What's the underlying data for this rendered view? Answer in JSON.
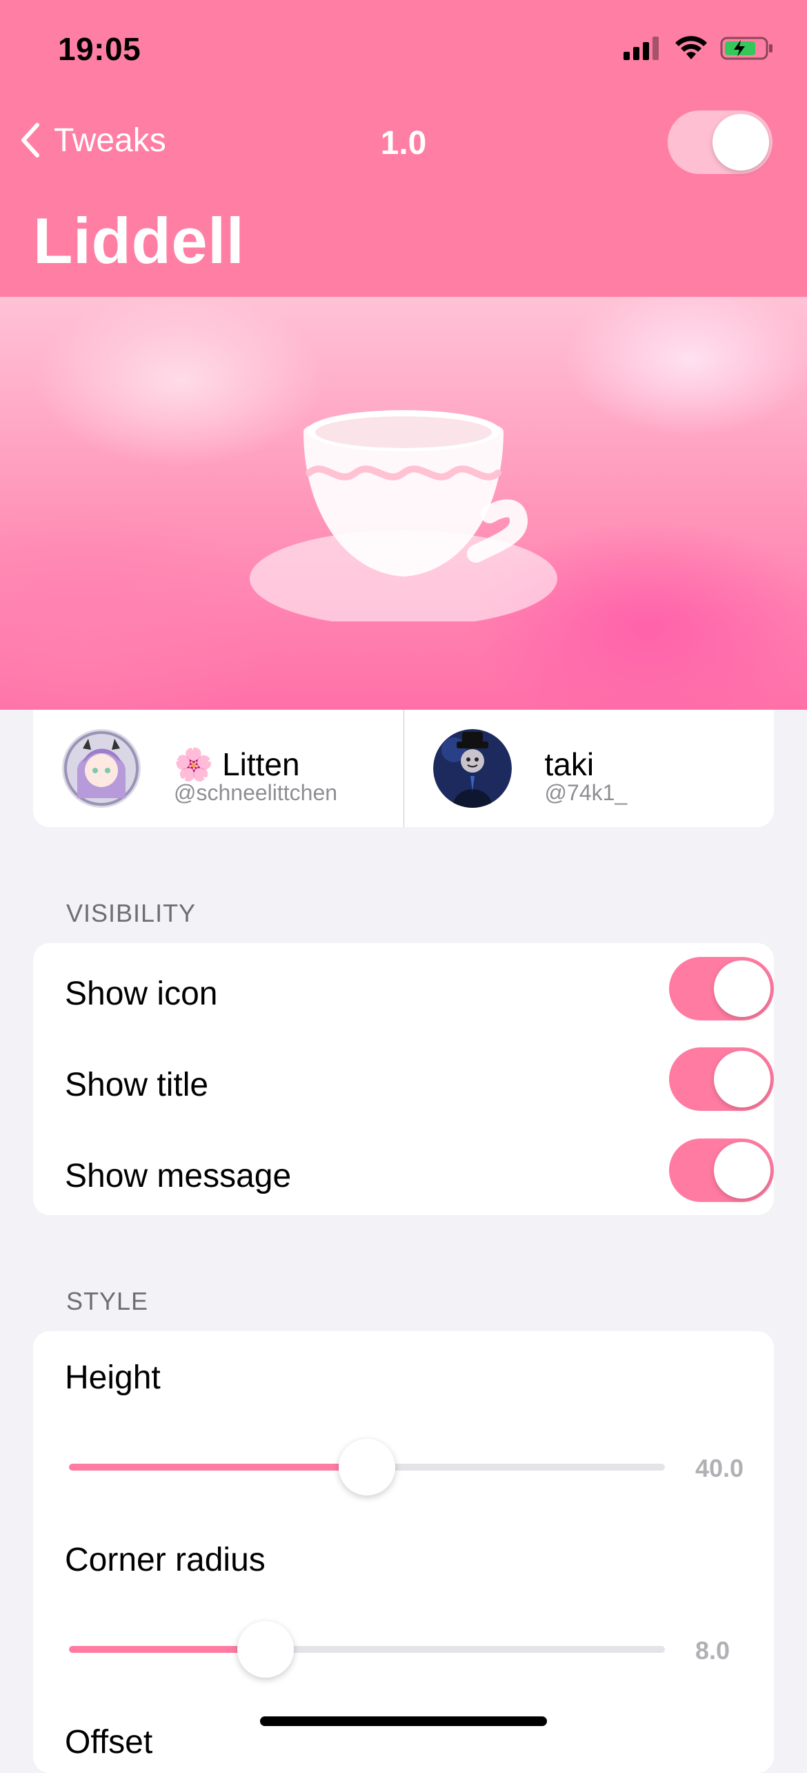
{
  "status_bar": {
    "time": "19:05"
  },
  "nav": {
    "back_label": "Tweaks",
    "title": "1.0",
    "enabled": true
  },
  "header": {
    "title": "Liddell"
  },
  "credits": [
    {
      "emoji": "🌸",
      "name": "Litten",
      "handle": "@schneelittchen"
    },
    {
      "name": "taki",
      "handle": "@74k1_"
    }
  ],
  "visibility": {
    "header": "VISIBILITY",
    "rows": [
      {
        "label": "Show icon",
        "on": true
      },
      {
        "label": "Show title",
        "on": true
      },
      {
        "label": "Show message",
        "on": true
      }
    ]
  },
  "style": {
    "header": "STYLE",
    "rows": [
      {
        "label": "Height",
        "value_text": "40.0",
        "fraction": 0.5
      },
      {
        "label": "Corner radius",
        "value_text": "8.0",
        "fraction": 0.33
      },
      {
        "label": "Offset"
      }
    ]
  },
  "colors": {
    "accent": "#ff7ba1",
    "header_bg": "#ff7fa4",
    "background": "#f2f2f7"
  }
}
